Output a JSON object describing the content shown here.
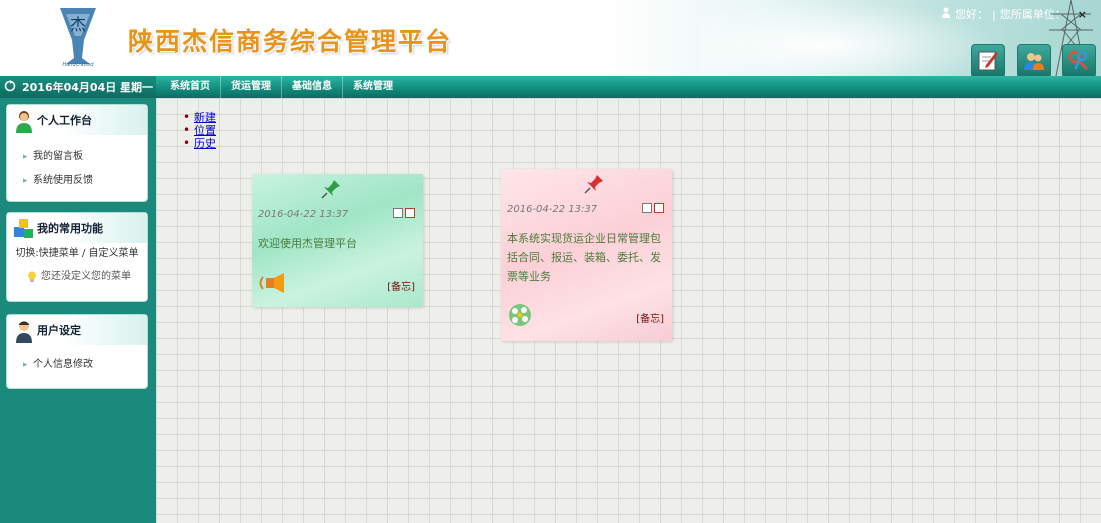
{
  "header": {
    "title": "陕西杰信商务综合管理平台",
    "greeting": "您好：",
    "unit_label": "您所属单位：",
    "close": "×"
  },
  "date_bar": {
    "text": "2016年04月04日 星期一"
  },
  "nav": {
    "tabs": [
      "系统首页",
      "货运管理",
      "基础信息",
      "系统管理"
    ]
  },
  "sidebar": {
    "panels": [
      {
        "title": "个人工作台",
        "items": [
          "我的留言板",
          "系统使用反馈"
        ]
      },
      {
        "title": "我的常用功能",
        "switch": "切换:快捷菜单 / 自定义菜单",
        "hint": "您还没定义您的菜单"
      },
      {
        "title": "用户设定",
        "items": [
          "个人信息修改"
        ]
      }
    ]
  },
  "main": {
    "links": [
      "新建",
      "位置",
      "历史"
    ],
    "notes": [
      {
        "date": "2016-04-22 13:37",
        "text": "欢迎使用杰管理平台",
        "tag": "[备忘]",
        "color": "#a8e8cb"
      },
      {
        "date": "2016-04-22 13:37",
        "text": "本系统实现货运企业日常管理包括合同、报运、装箱、委托、发票等业务",
        "tag": "[备忘]",
        "color": "#fbd0d7"
      }
    ]
  },
  "colors": {
    "accent": "#1b8a7c",
    "title": "#e8931a",
    "link": "#0000cc"
  },
  "icons": [
    "logo",
    "edit-icon",
    "users-icon",
    "keys-icon",
    "refresh-icon",
    "pushpin-icon",
    "speaker-icon",
    "flower-icon"
  ]
}
